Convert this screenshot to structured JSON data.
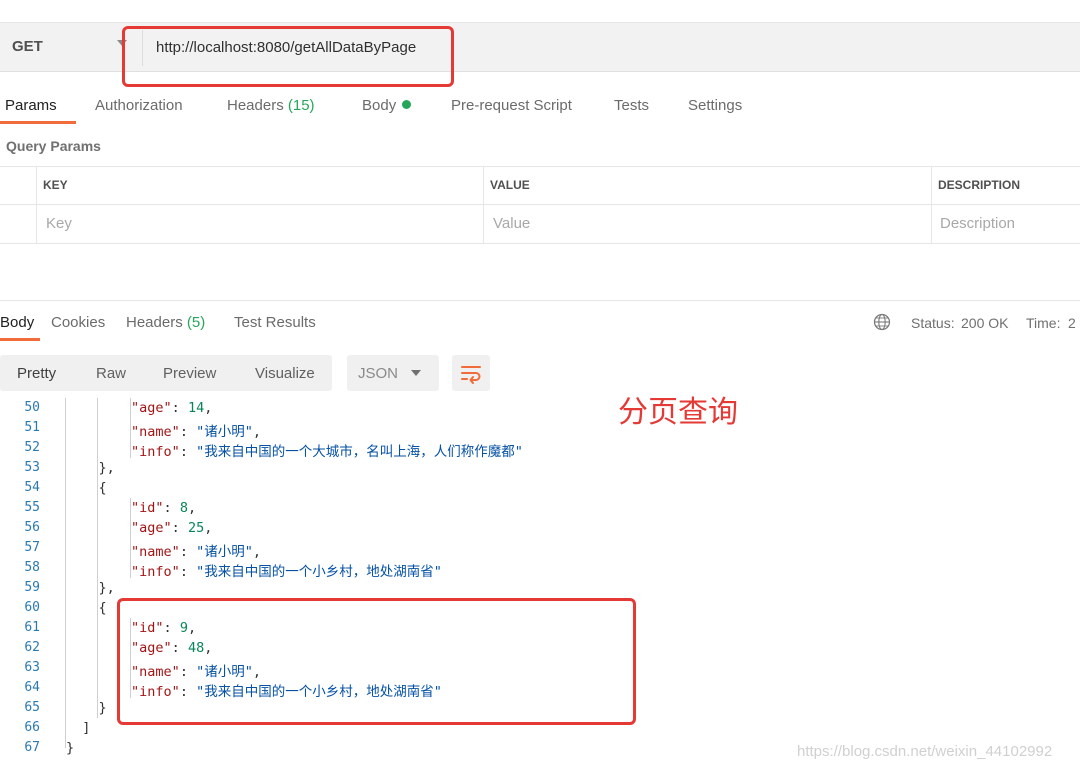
{
  "request": {
    "method": "GET",
    "url": "http://localhost:8080/getAllDataByPage"
  },
  "request_tabs": [
    {
      "label": "Params",
      "count": ""
    },
    {
      "label": "Authorization",
      "count": ""
    },
    {
      "label": "Headers",
      "count": "(15)"
    },
    {
      "label": "Body",
      "count": ""
    },
    {
      "label": "Pre-request Script",
      "count": ""
    },
    {
      "label": "Tests",
      "count": ""
    },
    {
      "label": "Settings",
      "count": ""
    }
  ],
  "query_params": {
    "title": "Query Params",
    "columns": [
      "KEY",
      "VALUE",
      "DESCRIPTION"
    ],
    "placeholders": [
      "Key",
      "Value",
      "Description"
    ]
  },
  "response_tabs": [
    {
      "label": "Body",
      "count": ""
    },
    {
      "label": "Cookies",
      "count": ""
    },
    {
      "label": "Headers",
      "count": "(5)"
    },
    {
      "label": "Test Results",
      "count": ""
    }
  ],
  "response_status": {
    "status_label": "Status:",
    "status_value": "200 OK",
    "time_label": "Time:",
    "time_value": "2"
  },
  "format_tabs": [
    "Pretty",
    "Raw",
    "Preview",
    "Visualize"
  ],
  "format_select": "JSON",
  "annotation": "分页查询",
  "watermark": "https://blog.csdn.net/weixin_44102992",
  "code": {
    "line_numbers": [
      "50",
      "51",
      "52",
      "53",
      "54",
      "55",
      "56",
      "57",
      "58",
      "59",
      "60",
      "61",
      "62",
      "63",
      "64",
      "65",
      "66",
      "67"
    ],
    "lines": [
      "        \"age\": 14,",
      "        \"name\": \"诸小明\",",
      "        \"info\": \"我来自中国的一个大城市，名叫上海，人们称作魔都\"",
      "    },",
      "    {",
      "        \"id\": 8,",
      "        \"age\": 25,",
      "        \"name\": \"诸小明\",",
      "        \"info\": \"我来自中国的一个小乡村，地处湖南省\"",
      "    },",
      "    {",
      "        \"id\": 9,",
      "        \"age\": 48,",
      "        \"name\": \"诸小明\",",
      "        \"info\": \"我来自中国的一个小乡村，地处湖南省\"",
      "    }",
      "  ]",
      "}"
    ]
  },
  "colors": {
    "accent": "#f26b3a",
    "status_green": "#26a65b",
    "annotation_red": "#e53935"
  },
  "icons": {
    "globe": "globe-icon",
    "wrap": "wrap-lines-icon"
  }
}
